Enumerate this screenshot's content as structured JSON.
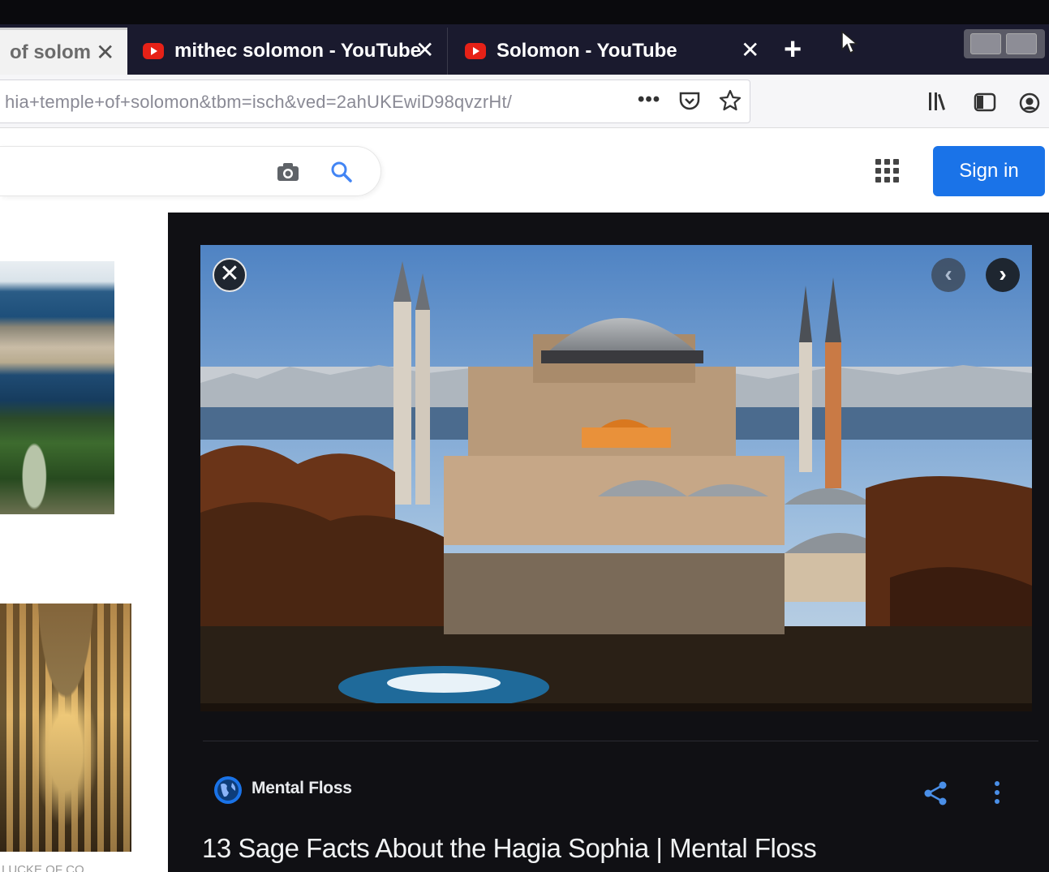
{
  "colors": {
    "tab_strip": "#1a1a2e",
    "sign_in_button": "#1a73e8",
    "preview_panel": "#101014",
    "youtube_red": "#e62117"
  },
  "browser": {
    "tabs": [
      {
        "title": "of solomo",
        "close_label": "✕",
        "icon": "none",
        "active": true
      },
      {
        "title": "mithec solomon - YouTube",
        "close_label": "✕",
        "icon": "youtube-icon",
        "active": false
      },
      {
        "title": "Solomon - YouTube",
        "close_label": "✕",
        "icon": "youtube-icon",
        "active": false
      }
    ],
    "new_tab_label": "+",
    "url": "hia+temple+of+solomon&tbm=isch&ved=2ahUKEwiD98qvzrHt/",
    "url_more_label": "•••",
    "toolbar_icons": [
      "pocket-icon",
      "star-icon",
      "library-icon",
      "sidebar-icon",
      "account-icon"
    ]
  },
  "google": {
    "search_icons": [
      "camera-icon",
      "search-icon"
    ],
    "apps_icon": "apps-grid-icon",
    "sign_in_label": "Sign in"
  },
  "results": {
    "caption": "LUCKE OF CO"
  },
  "preview": {
    "close_label": "✕",
    "prev_label": "‹",
    "next_label": "›",
    "source_name": "Mental Floss",
    "title": "13 Sage Facts About the Hagia Sophia | Mental Floss",
    "more_label": "⋮"
  }
}
